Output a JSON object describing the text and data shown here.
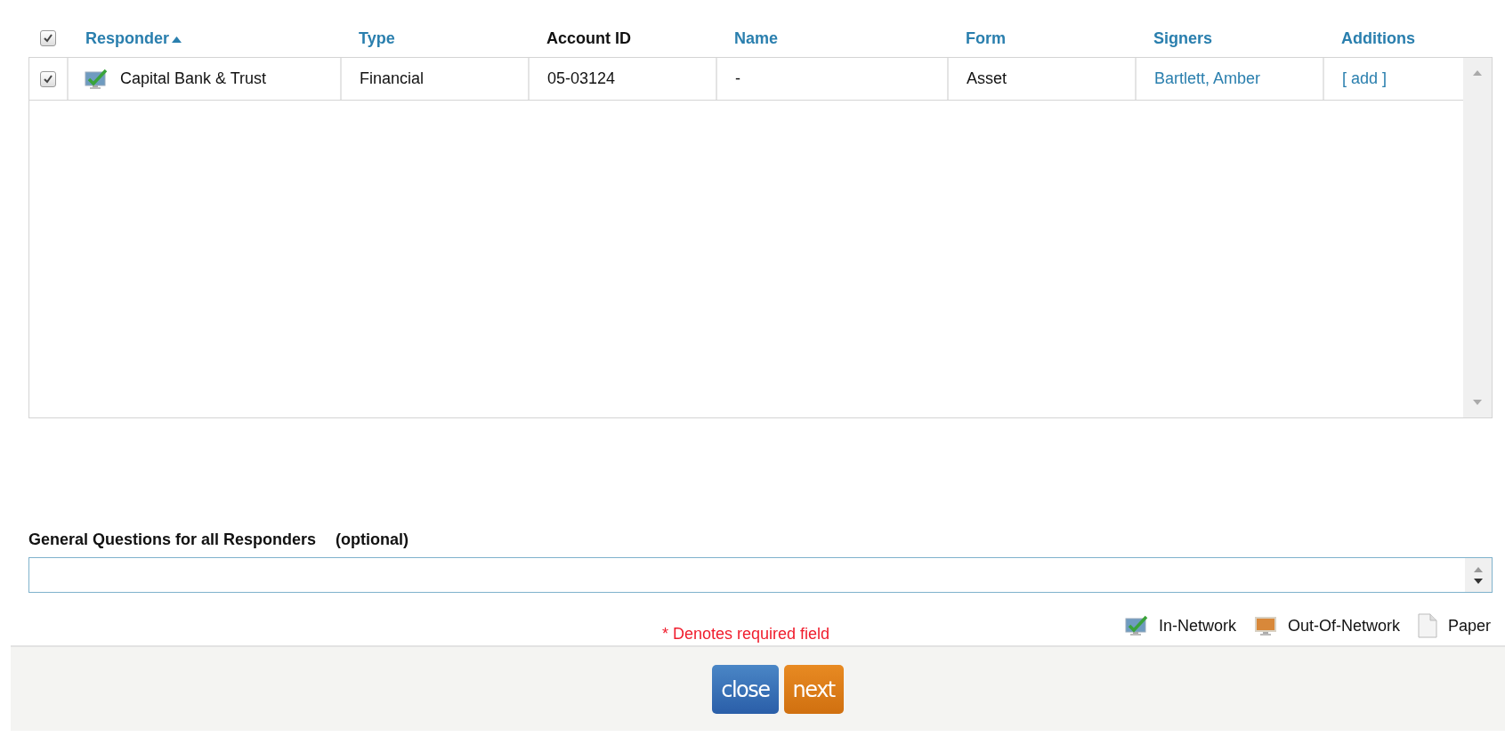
{
  "table": {
    "all_checked": true,
    "columns": [
      {
        "label": "Responder",
        "sortable": true,
        "sorted": true
      },
      {
        "label": "Type",
        "sortable": true,
        "sorted": false
      },
      {
        "label": "Account ID",
        "sortable": false,
        "sorted": false
      },
      {
        "label": "Name",
        "sortable": true,
        "sorted": false
      },
      {
        "label": "Form",
        "sortable": true,
        "sorted": false
      },
      {
        "label": "Signers",
        "sortable": true,
        "sorted": false
      },
      {
        "label": "Additions",
        "sortable": true,
        "sorted": false
      }
    ],
    "rows": [
      {
        "checked": true,
        "kind": "in-network",
        "responder": "Capital Bank & Trust",
        "type": "Financial",
        "account_id": "05-03124",
        "name": "-",
        "form": "Asset",
        "signers": "Bartlett, Amber",
        "additions": "[ add ]"
      }
    ]
  },
  "questions": {
    "label": "General Questions for all Responders",
    "optional": "(optional)"
  },
  "required_note": "* Denotes required field",
  "legend": [
    {
      "kind": "in-network",
      "label": "In-Network"
    },
    {
      "kind": "out-of-network",
      "label": "Out-Of-Network"
    },
    {
      "kind": "paper",
      "label": "Paper"
    }
  ],
  "buttons": [
    {
      "kind": "close",
      "label": "close"
    },
    {
      "kind": "next",
      "label": "next"
    }
  ]
}
